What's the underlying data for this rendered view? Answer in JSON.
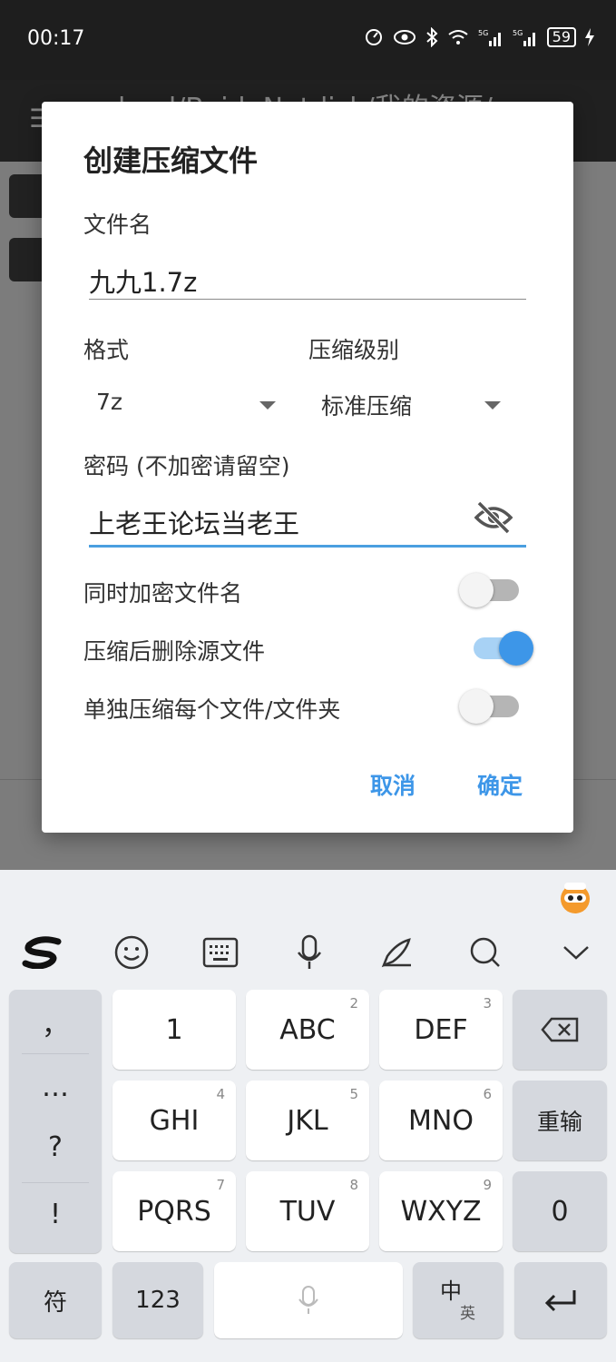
{
  "status": {
    "time": "00:17",
    "battery": "59"
  },
  "toolbar": {
    "path_title": "load/BaiduNetdisk/我的资源/"
  },
  "dialog": {
    "title": "创建压缩文件",
    "filename_label": "文件名",
    "filename_value": "九九1.7z",
    "format_label": "格式",
    "format_value": "7z",
    "level_label": "压缩级别",
    "level_value": "标准压缩",
    "password_label": "密码 (不加密请留空)",
    "password_value": "上老王论坛当老王",
    "toggles": [
      {
        "label": "同时加密文件名",
        "on": false
      },
      {
        "label": "压缩后删除源文件",
        "on": true
      },
      {
        "label": "单独压缩每个文件/文件夹",
        "on": false
      }
    ],
    "cancel_label": "取消",
    "ok_label": "确定"
  },
  "keyboard": {
    "keys": {
      "k1": "1",
      "k2": "ABC",
      "k2n": "2",
      "k3": "DEF",
      "k3n": "3",
      "k4": "GHI",
      "k4n": "4",
      "k5": "JKL",
      "k5n": "5",
      "k6": "MNO",
      "k6n": "6",
      "k7": "PQRS",
      "k7n": "7",
      "k8": "TUV",
      "k8n": "8",
      "k9": "WXYZ",
      "k9n": "9",
      "k0": "0",
      "reset": "重输",
      "symbols": "符",
      "num": "123",
      "lang_main": "中",
      "lang_sub": "英"
    },
    "side_symbols": [
      "，",
      "…",
      "?",
      "!"
    ]
  },
  "colors": {
    "accent": "#3d96e8"
  }
}
